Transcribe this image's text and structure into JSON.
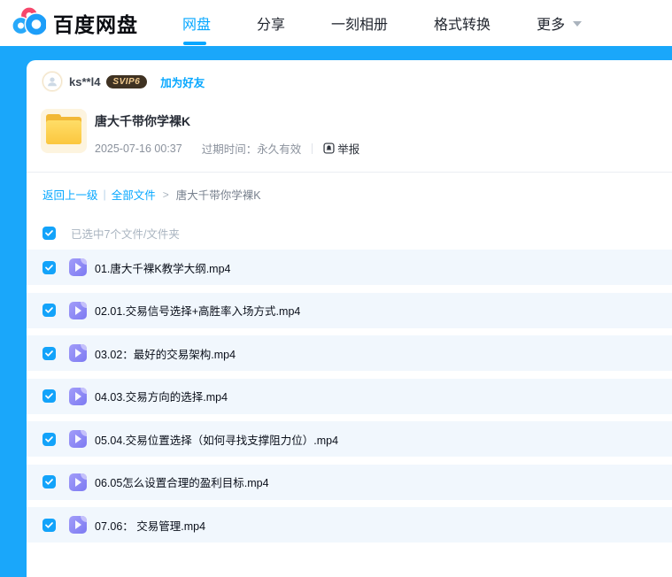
{
  "brand": {
    "name": "百度网盘"
  },
  "nav": {
    "items": [
      {
        "label": "网盘",
        "active": true
      },
      {
        "label": "分享",
        "active": false
      },
      {
        "label": "一刻相册",
        "active": false
      },
      {
        "label": "格式转换",
        "active": false
      },
      {
        "label": "更多",
        "active": false,
        "has_dropdown": true
      }
    ]
  },
  "user": {
    "name": "ks**l4",
    "badge": "SVIP6",
    "add_friend_label": "加为好友"
  },
  "share": {
    "title": "唐大千带你学裸K",
    "date": "2025-07-16 00:37",
    "expire_label": "过期时间：永久有效",
    "report_label": "举报"
  },
  "breadcrumb": {
    "back_label": "返回上一级",
    "pipe": "|",
    "all_files_label": "全部文件",
    "separator": ">",
    "current": "唐大千带你学裸K"
  },
  "selection": {
    "summary": "已选中7个文件/文件夹",
    "all_checked": true
  },
  "files": [
    {
      "name": "01.唐大千裸K教学大纲.mp4",
      "type": "video",
      "checked": true
    },
    {
      "name": "02.01.交易信号选择+高胜率入场方式.mp4",
      "type": "video",
      "checked": true
    },
    {
      "name": "03.02：最好的交易架构.mp4",
      "type": "video",
      "checked": true
    },
    {
      "name": "04.03.交易方向的选择.mp4",
      "type": "video",
      "checked": true
    },
    {
      "name": "05.04.交易位置选择（如何寻找支撑阻力位）.mp4",
      "type": "video",
      "checked": true
    },
    {
      "name": "06.05怎么设置合理的盈利目标.mp4",
      "type": "video",
      "checked": true
    },
    {
      "name": "07.06： 交易管理.mp4",
      "type": "video",
      "checked": true
    }
  ],
  "colors": {
    "accent_blue": "#06a7ff",
    "page_background_blue": "#1aa7fa",
    "row_background": "#f1f7fd",
    "badge_background": "#3f3222",
    "badge_text": "#f2cb8f",
    "video_icon_purple": "#7d7af2",
    "folder_yellow": "#fbc73f"
  }
}
